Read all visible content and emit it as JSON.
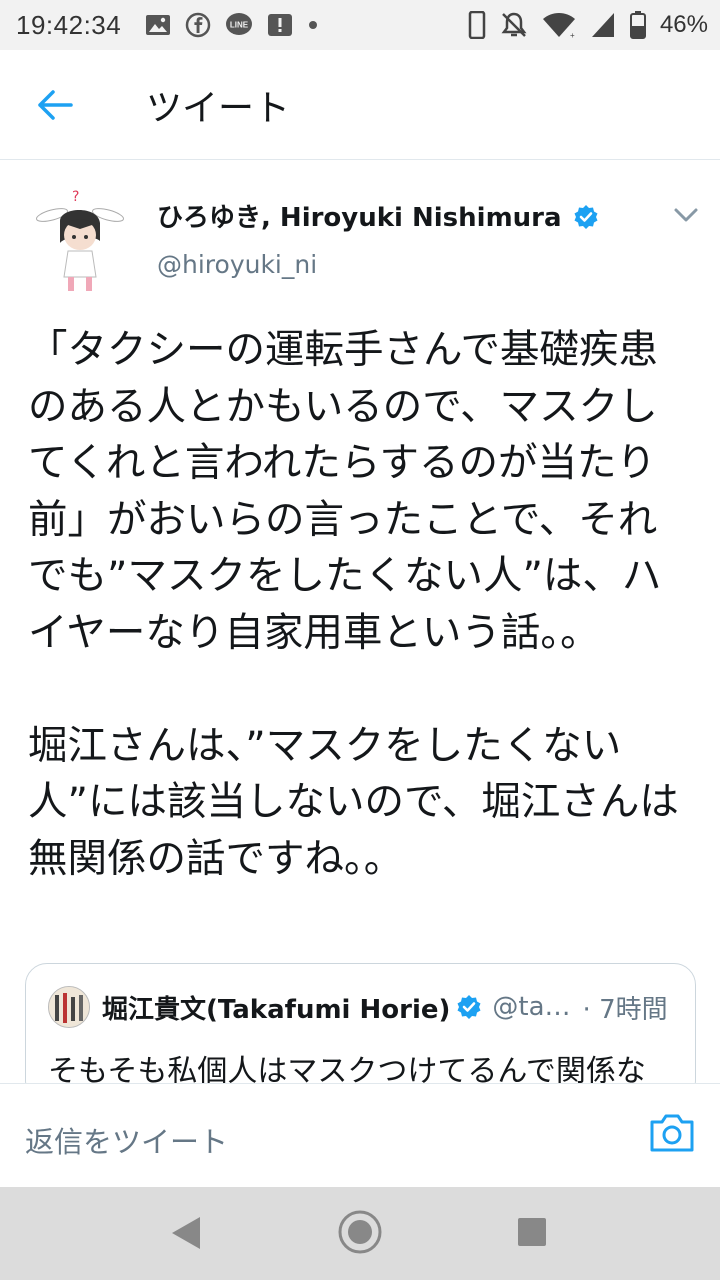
{
  "status_bar": {
    "time": "19:42:34",
    "battery": "46%",
    "left_icons": [
      "image-icon",
      "facebook-icon",
      "line-icon",
      "alert-icon",
      "dot-icon"
    ],
    "right_icons": [
      "phone-icon",
      "mute-icon",
      "wifi-icon",
      "signal-icon",
      "battery-icon"
    ]
  },
  "app_bar": {
    "title": "ツイート",
    "back_icon": "arrow-left-icon",
    "accent": "#1da1f2"
  },
  "tweet": {
    "author_name": "ひろゆき, Hiroyuki Nishimura",
    "author_handle": "@hiroyuki_ni",
    "verified": true,
    "text": "「タクシーの運転手さんで基礎疾患のある人とかもいるので、マスクしてくれと言われたらするのが当たり前」がおいらの言ったことで、それでも”マスクをしたくない人”は、ハイヤーなり自家用車という話。。\n\n堀江さんは、”マスクをしたくない人”には該当しないので、堀江さんは無関係の話ですね。。"
  },
  "quote": {
    "author_name": "堀江貴文(Takafumi Horie)",
    "author_handle": "@ta…",
    "time": "· 7時間",
    "verified": true,
    "text": "そもそも私個人はマスクつけてるんで関係な"
  },
  "reply": {
    "placeholder": "返信をツイート",
    "camera_icon": "camera-icon"
  },
  "nav": {
    "icons": [
      "back-triangle-icon",
      "home-circle-icon",
      "recents-square-icon"
    ]
  }
}
